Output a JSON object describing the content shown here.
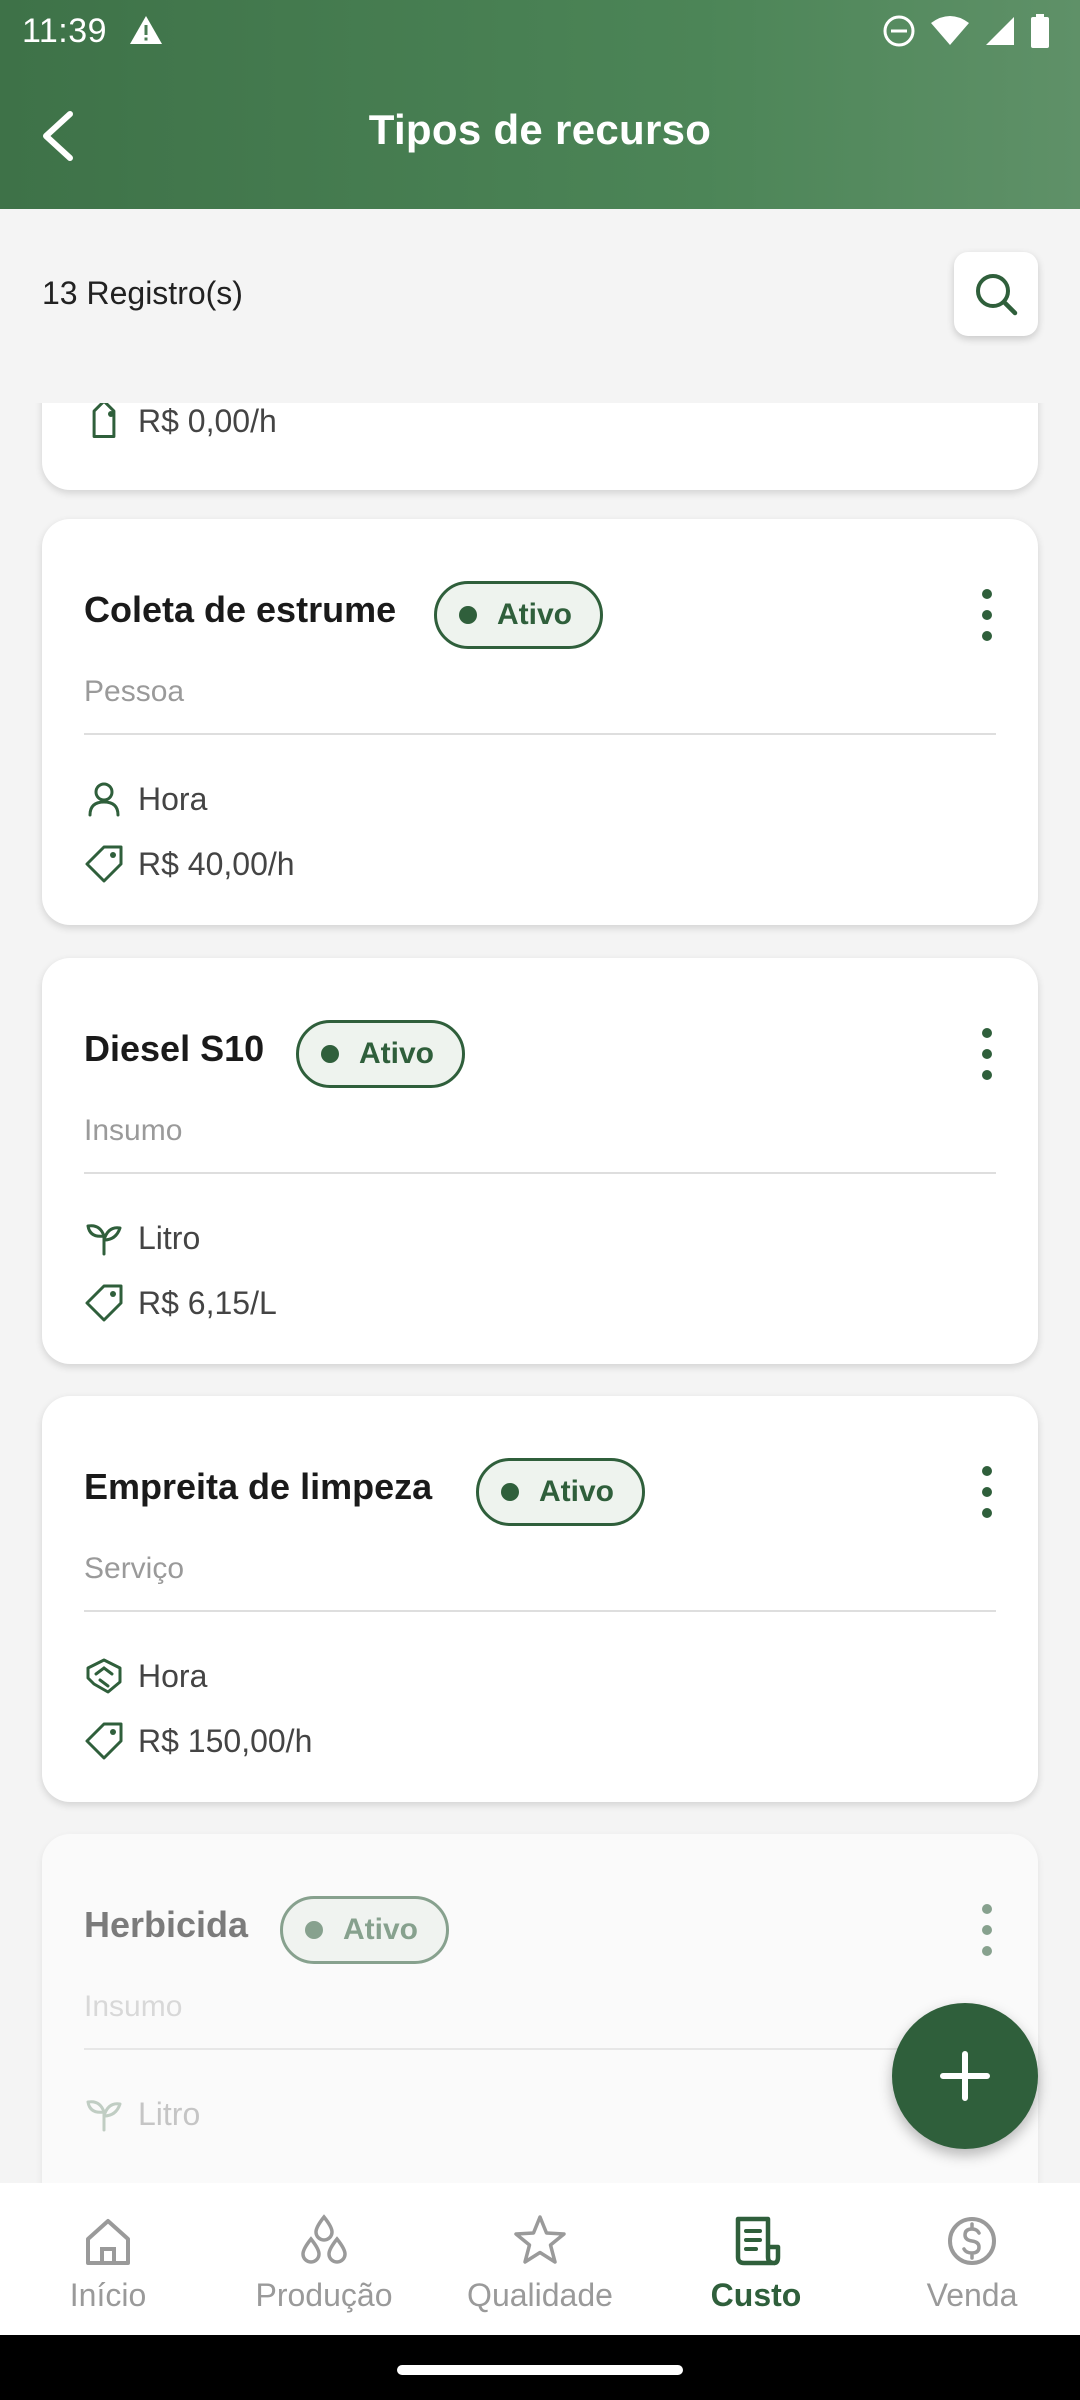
{
  "status_bar": {
    "time": "11:39"
  },
  "header": {
    "title": "Tipos de recurso"
  },
  "toolbar": {
    "count_label": "13 Registro(s)"
  },
  "partial_card": {
    "price": "R$ 0,00/h"
  },
  "cards": [
    {
      "title": "Coleta de estrume",
      "status": "Ativo",
      "type": "Pessoa",
      "unit": "Hora",
      "unit_icon": "person-icon",
      "price": "R$ 40,00/h"
    },
    {
      "title": "Diesel S10",
      "status": "Ativo",
      "type": "Insumo",
      "unit": "Litro",
      "unit_icon": "sprout-icon",
      "price": "R$ 6,15/L"
    },
    {
      "title": "Empreita de limpeza",
      "status": "Ativo",
      "type": "Serviço",
      "unit": "Hora",
      "unit_icon": "handshake-icon",
      "price": "R$ 150,00/h"
    },
    {
      "title": "Herbicida",
      "status": "Ativo",
      "type": "Insumo",
      "unit": "Litro",
      "unit_icon": "sprout-icon"
    }
  ],
  "bottom_nav": [
    {
      "label": "Início",
      "icon": "home-icon",
      "active": false
    },
    {
      "label": "Produção",
      "icon": "drops-icon",
      "active": false
    },
    {
      "label": "Qualidade",
      "icon": "star-icon",
      "active": false
    },
    {
      "label": "Custo",
      "icon": "receipt-icon",
      "active": true
    },
    {
      "label": "Venda",
      "icon": "coin-icon",
      "active": false
    }
  ],
  "colors": {
    "primary": "#2f5f3b",
    "header": "#4c8557",
    "muted": "#9a9a9a"
  }
}
